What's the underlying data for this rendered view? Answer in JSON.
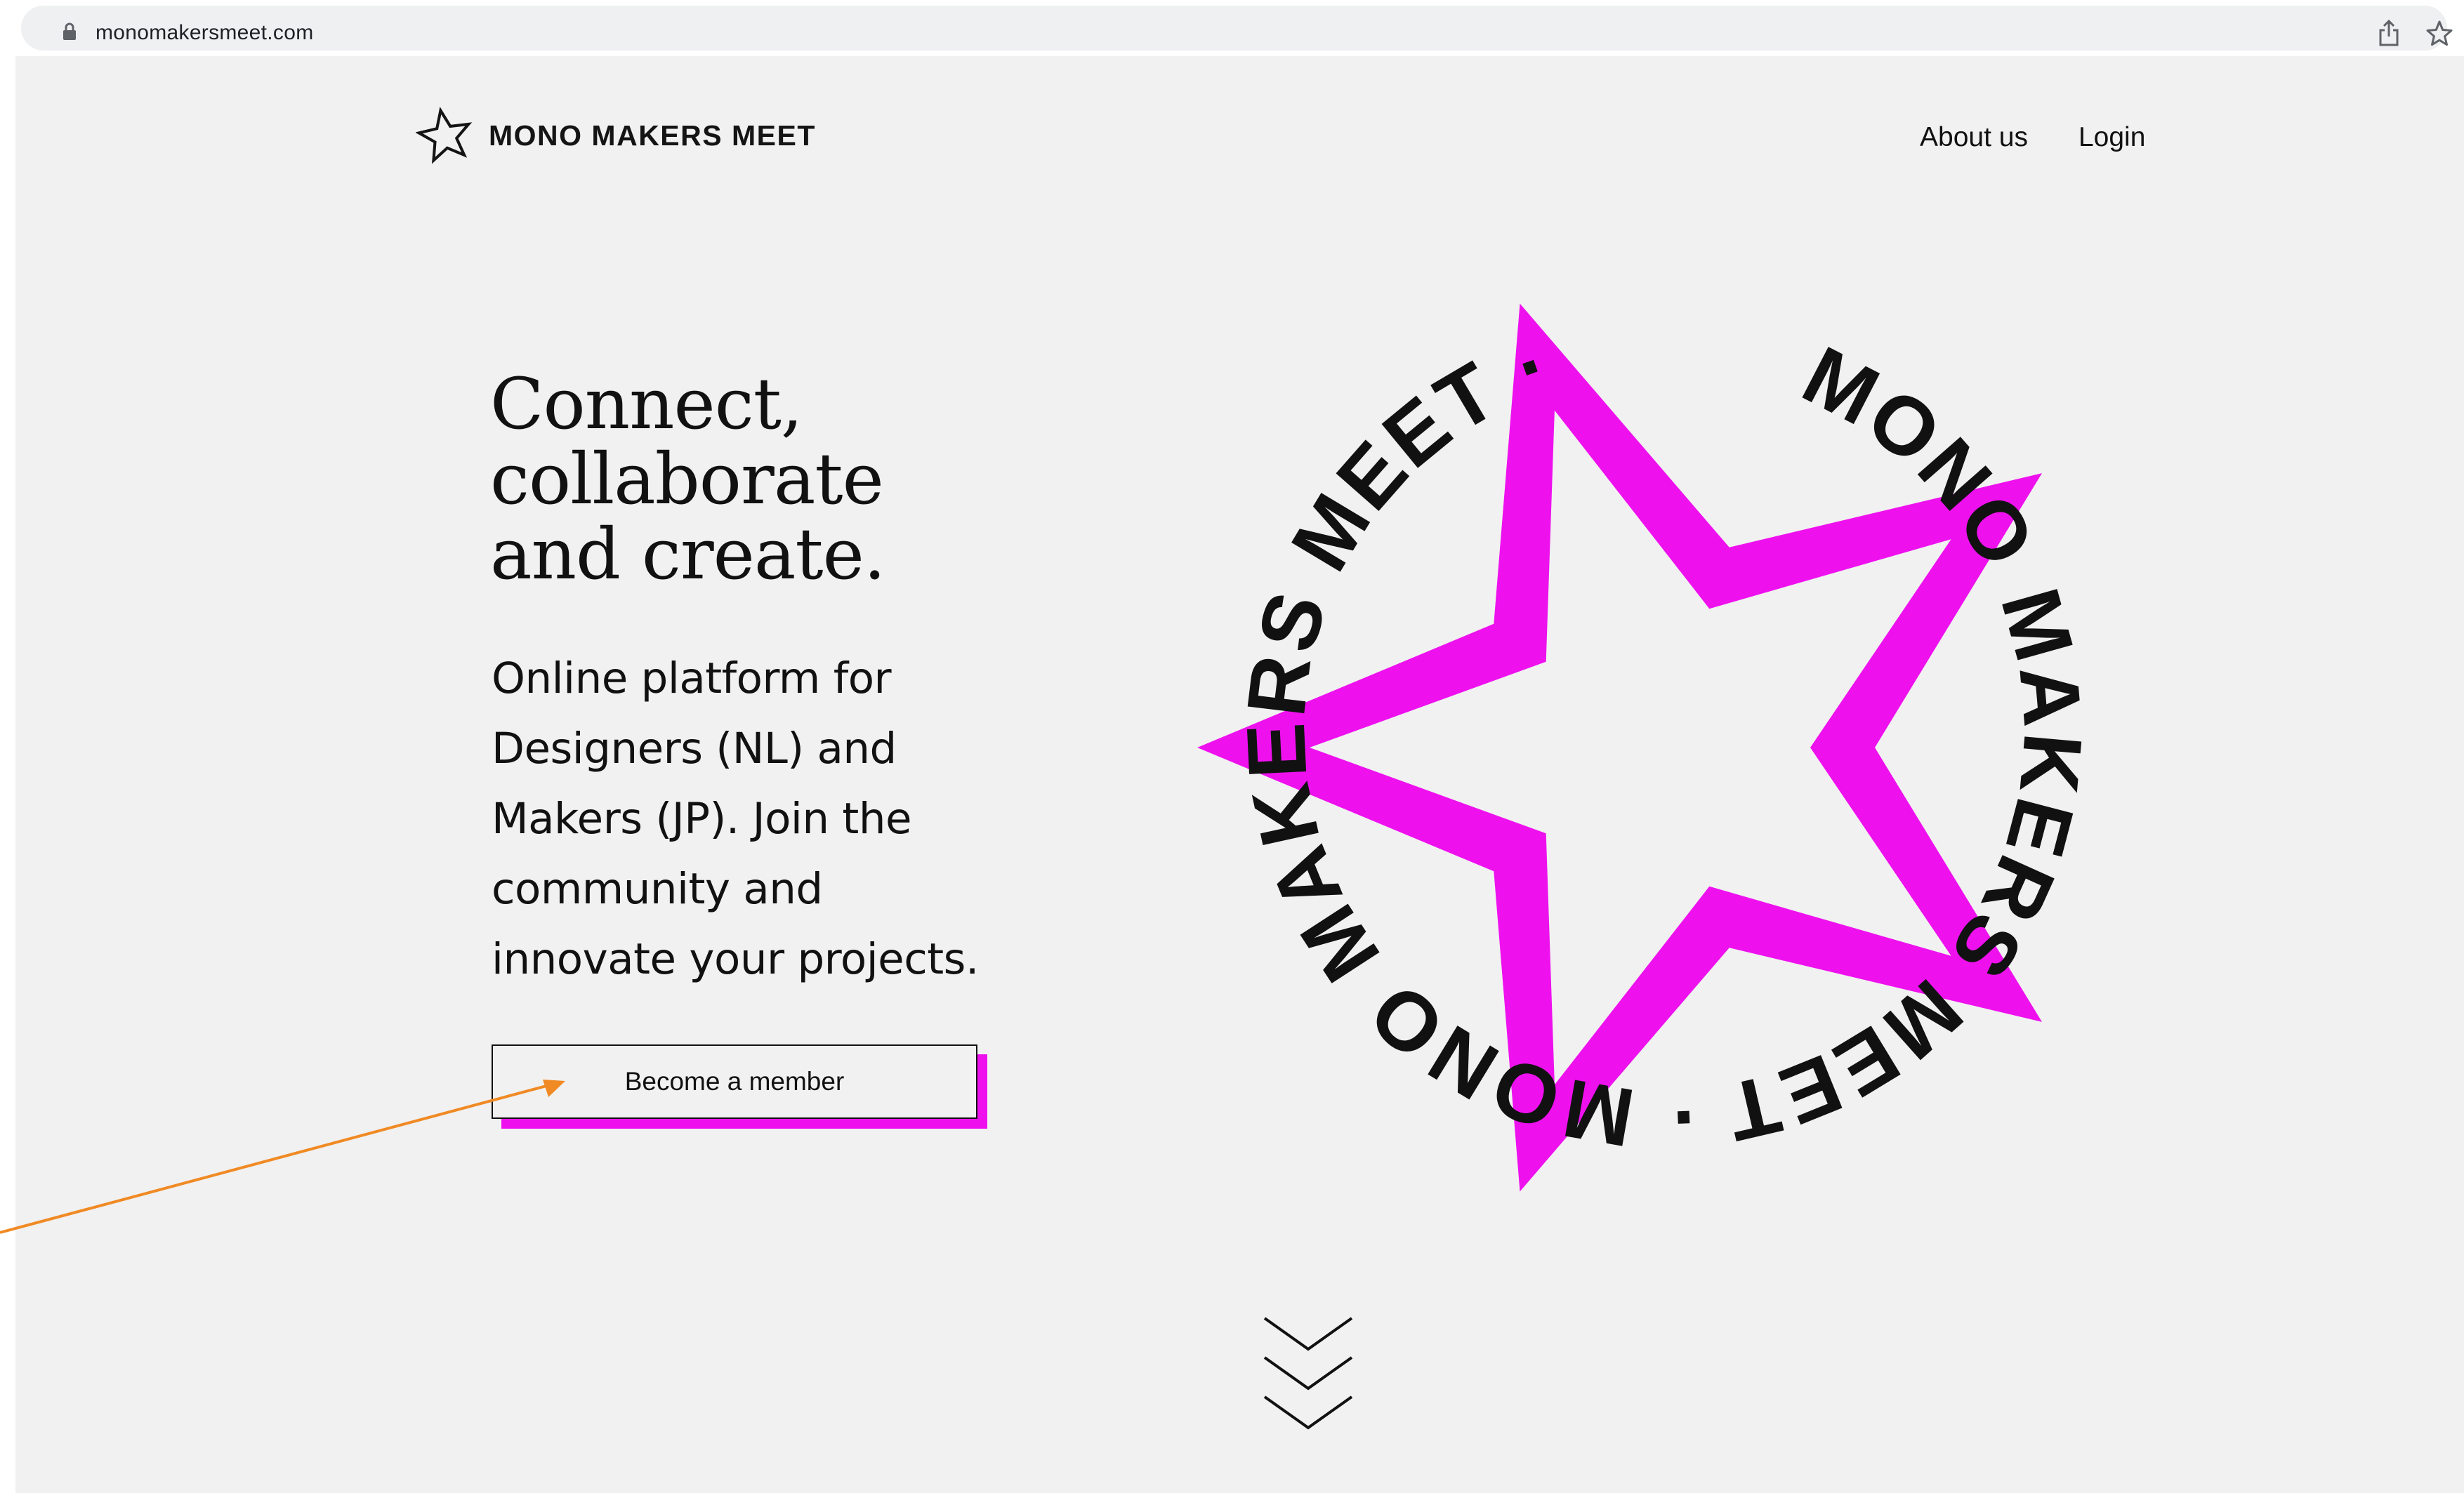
{
  "browser": {
    "url": "monomakersmeet.com"
  },
  "header": {
    "logo_text": "MONO MAKERS MEET",
    "nav": [
      {
        "label": "About us"
      },
      {
        "label": "Login"
      }
    ]
  },
  "hero": {
    "title_lines": [
      "Connect,",
      "collaborate",
      "and create."
    ],
    "description_lines": [
      "Online platform for",
      "Designers (NL) and",
      "Makers (JP). Join the",
      "community and",
      "innovate your projects."
    ],
    "cta_label": "Become a member"
  },
  "graphic": {
    "ring_text": "MONO MAKERS MEET · MONO MAKERS MEET ·"
  },
  "colors": {
    "accent": "#ee11ee",
    "background": "#f1f1f1",
    "text": "#111111",
    "annotation_arrow": "#f08a24"
  }
}
